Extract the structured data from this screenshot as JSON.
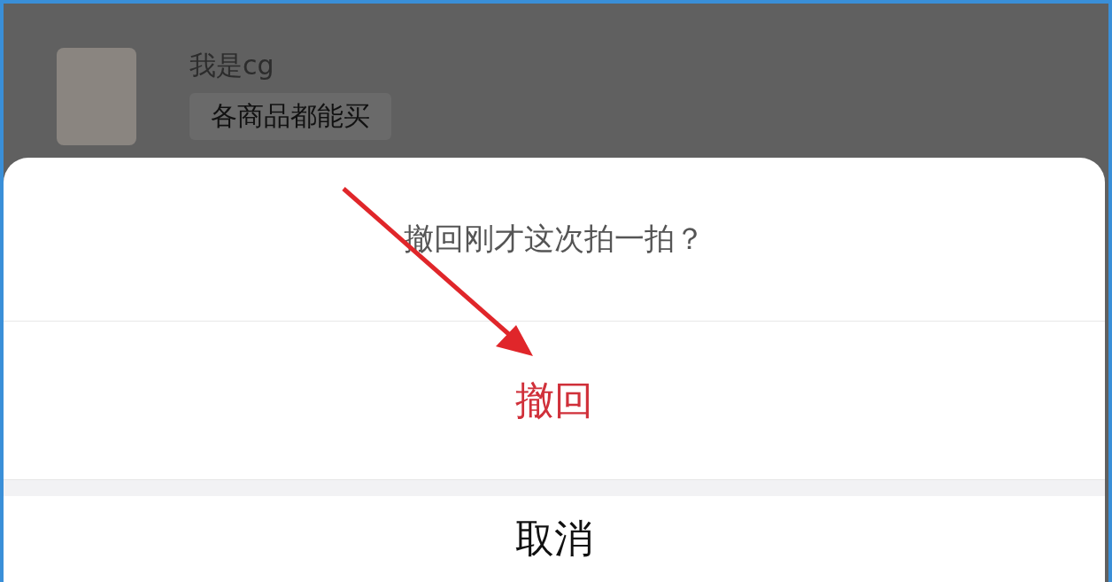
{
  "chat": {
    "sender": "我是cg",
    "message": "各商品都能买"
  },
  "sheet": {
    "title": "撤回刚才这次拍一拍？",
    "actions": [
      {
        "label": "撤回",
        "kind": "destructive"
      },
      {
        "label": "取消",
        "kind": "cancel"
      }
    ]
  }
}
